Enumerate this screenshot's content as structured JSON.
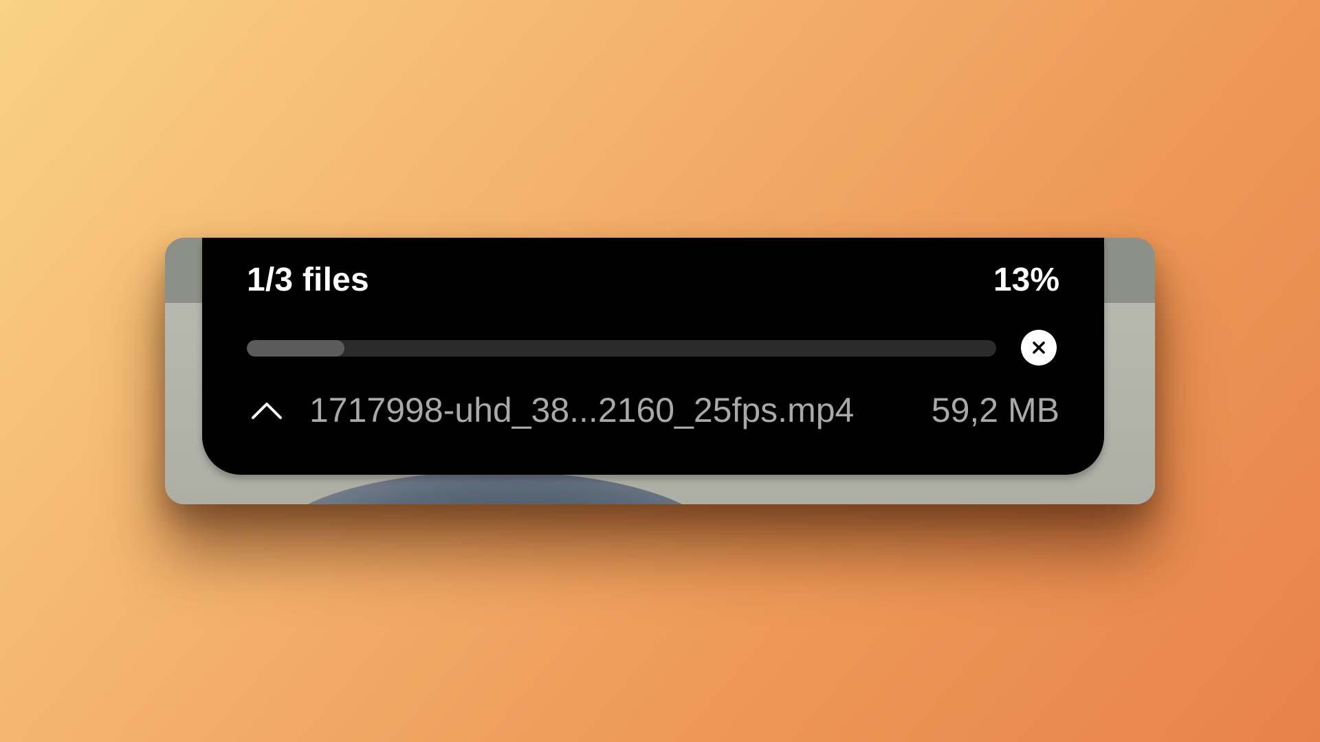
{
  "upload": {
    "files_count": "1/3 files",
    "percent_label": "13%",
    "progress": 0.13,
    "current_file": {
      "name": "1717998-uhd_38...2160_25fps.mp4",
      "size": "59,2 MB"
    }
  },
  "icons": {
    "cancel": "close-icon",
    "expand": "chevron-up-icon"
  },
  "colors": {
    "panel": "#000000",
    "primary_text": "#ffffff",
    "secondary_text": "#a9a9a9",
    "track": "#2b2b2b",
    "fill": "#5b5b5b"
  }
}
